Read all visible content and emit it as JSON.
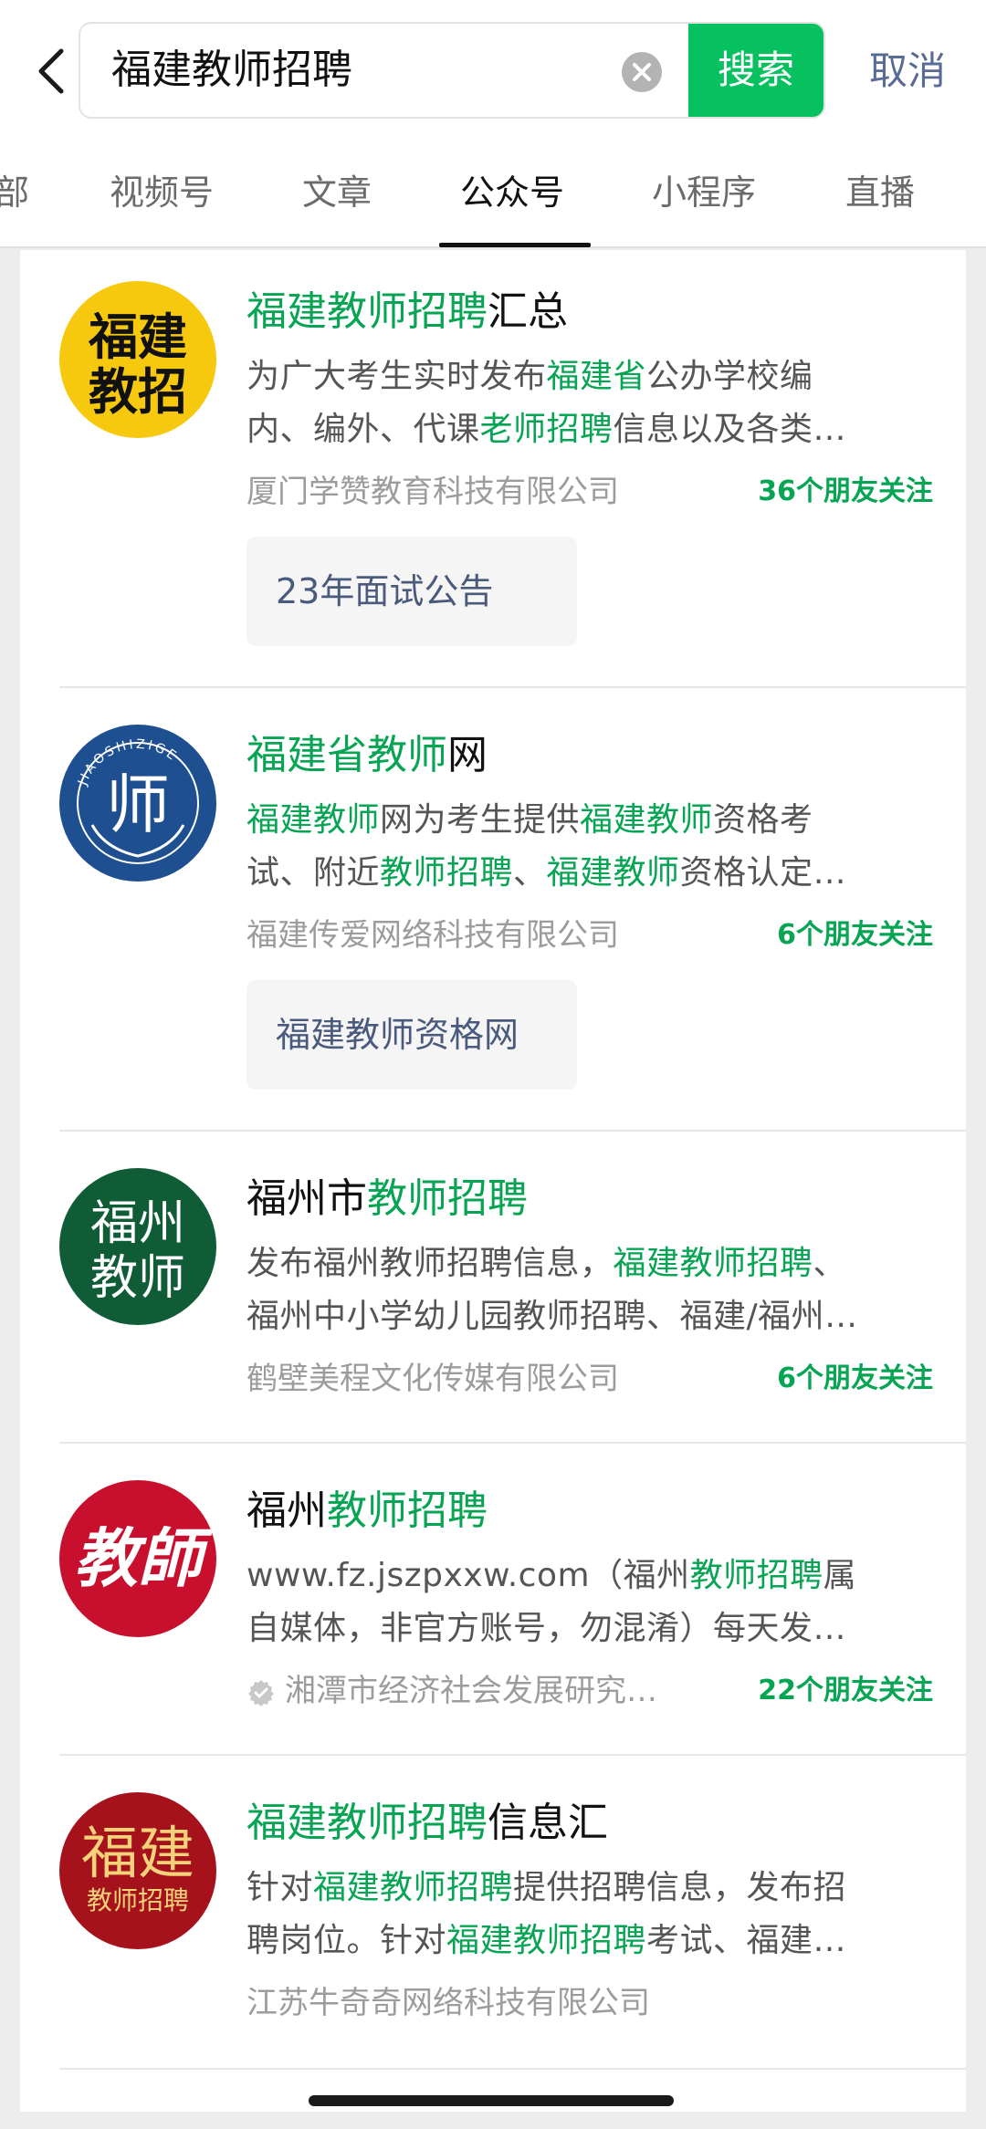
{
  "search": {
    "query": "福建教师招聘",
    "button_label": "搜索",
    "cancel_label": "取消"
  },
  "tabs": [
    {
      "label": "部"
    },
    {
      "label": "视频号"
    },
    {
      "label": "文章"
    },
    {
      "label": "公众号",
      "active": true
    },
    {
      "label": "小程序"
    },
    {
      "label": "直播"
    }
  ],
  "results": [
    {
      "avatar_text": [
        "福建",
        "教招"
      ],
      "avatar_bg": "#f6c90e",
      "title": [
        {
          "t": "福建教师招聘",
          "hl": true
        },
        {
          "t": "汇总",
          "hl": false
        }
      ],
      "desc_lines": [
        [
          {
            "t": "为广大考生实时发布",
            "hl": false
          },
          {
            "t": "福建省",
            "hl": true
          },
          {
            "t": "公办学校编",
            "hl": false
          }
        ],
        [
          {
            "t": "内、编外、代课",
            "hl": false
          },
          {
            "t": "老师招聘",
            "hl": true
          },
          {
            "t": "信息以及各类…",
            "hl": false
          }
        ]
      ],
      "company": "厦门学赞教育科技有限公司",
      "friends": "36个朋友关注",
      "chip": "23年面试公告"
    },
    {
      "avatar_text": [
        "师"
      ],
      "avatar_ring_text": "JIAOSHIZIGE",
      "avatar_bg": "#1d4f91",
      "title": [
        {
          "t": "福建省教师",
          "hl": true
        },
        {
          "t": "网",
          "hl": false
        }
      ],
      "desc_lines": [
        [
          {
            "t": "福建教师",
            "hl": true
          },
          {
            "t": "网为考生提供",
            "hl": false
          },
          {
            "t": "福建教师",
            "hl": true
          },
          {
            "t": "资格考",
            "hl": false
          }
        ],
        [
          {
            "t": "试、附近",
            "hl": false
          },
          {
            "t": "教师招聘",
            "hl": true
          },
          {
            "t": "、",
            "hl": false
          },
          {
            "t": "福建教师",
            "hl": true
          },
          {
            "t": "资格认定…",
            "hl": false
          }
        ]
      ],
      "company": "福建传爱网络科技有限公司",
      "friends": "6个朋友关注",
      "chip": "福建教师资格网"
    },
    {
      "avatar_text": [
        "福州",
        "教师"
      ],
      "avatar_bg": "#0f5c36",
      "title": [
        {
          "t": "福州市",
          "hl": false
        },
        {
          "t": "教师招聘",
          "hl": true
        }
      ],
      "desc_lines": [
        [
          {
            "t": "发布福州教师招聘信息，",
            "hl": false
          },
          {
            "t": "福建教师招聘",
            "hl": true
          },
          {
            "t": "、",
            "hl": false
          }
        ],
        [
          {
            "t": "福州中小学幼儿园教师招聘、福建/福州…",
            "hl": false
          }
        ]
      ],
      "company": "鹤壁美程文化传媒有限公司",
      "friends": "6个朋友关注"
    },
    {
      "avatar_text": [
        "教師"
      ],
      "avatar_bg": "#c8102e",
      "title": [
        {
          "t": "福州",
          "hl": false
        },
        {
          "t": "教师招聘",
          "hl": true
        }
      ],
      "desc_lines": [
        [
          {
            "t": "www.fz.jszpxxw.com（福州",
            "hl": false
          },
          {
            "t": "教师招聘",
            "hl": true
          },
          {
            "t": "属",
            "hl": false
          }
        ],
        [
          {
            "t": "自媒体，非官方账号，勿混淆）每天发…",
            "hl": false
          }
        ]
      ],
      "company": "湘潭市经济社会发展研究…",
      "verified": true,
      "friends": "22个朋友关注"
    },
    {
      "avatar_text": [
        "福建",
        "教师招聘"
      ],
      "avatar_bg": "#a5121c",
      "title": [
        {
          "t": "福建教师招聘",
          "hl": true
        },
        {
          "t": "信息汇",
          "hl": false
        }
      ],
      "desc_lines": [
        [
          {
            "t": "针对",
            "hl": false
          },
          {
            "t": "福建教师招聘",
            "hl": true
          },
          {
            "t": "提供招聘信息，发布招",
            "hl": false
          }
        ],
        [
          {
            "t": "聘岗位。针对",
            "hl": false
          },
          {
            "t": "福建教师招聘",
            "hl": true
          },
          {
            "t": "考试、福建…",
            "hl": false
          }
        ]
      ],
      "company": "江苏牛奇奇网络科技有限公司"
    }
  ],
  "colors": {
    "accent": "#07c160",
    "highlight": "#07a553",
    "link": "#576b95"
  }
}
